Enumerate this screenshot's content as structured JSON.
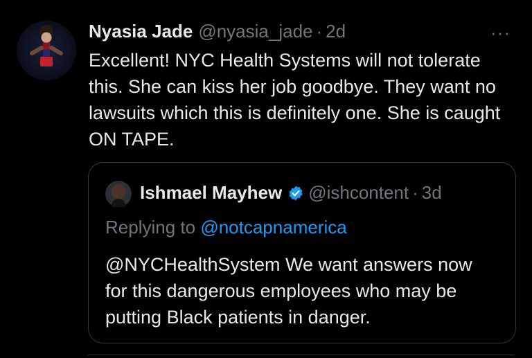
{
  "post": {
    "author_name": "Nyasia Jade",
    "author_handle": "@nyasia_jade",
    "separator": "·",
    "time": "2d",
    "more_label": "···",
    "text": "Excellent! NYC Health Systems will not tolerate this. She can kiss her job goodbye. They want no lawsuits which this is definitely one. She is caught ON TAPE."
  },
  "quoted_post": {
    "author_name": "Ishmael Mayhew",
    "verified": true,
    "author_handle": "@ishcontent",
    "separator": "·",
    "time": "3d",
    "replying_prefix": "Replying to ",
    "replying_to": "@notcapnamerica",
    "text": "@NYCHealthSystem We want answers now for this dangerous employees who may be putting Black patients in danger."
  },
  "colors": {
    "background": "#000000",
    "primary_text": "#e7e9ea",
    "secondary_text": "#71767b",
    "link": "#1d9bf0",
    "verified_badge": "#1d9bf0",
    "border": "#333639"
  },
  "icons": {
    "more": "more-horizontal-icon",
    "verified": "verified-badge-icon"
  }
}
